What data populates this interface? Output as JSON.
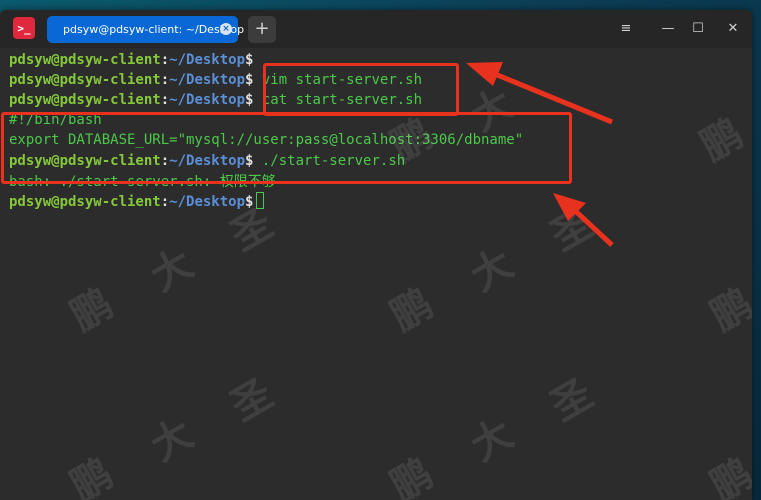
{
  "window": {
    "tab_title": "pdsyw@pdsyw-client: ~/Desktop",
    "tab_close_icon": "×",
    "new_tab_icon": "+",
    "menu_icon": "≡",
    "minimize_icon": "—",
    "maximize_icon": "☐",
    "close_icon": "✕",
    "app_icon_glyph": ">_"
  },
  "terminal": {
    "prompt_user": "pdsyw@pdsyw-client",
    "prompt_colon": ":",
    "prompt_path": "~/Desktop",
    "prompt_dollar": "$",
    "lines": [
      {
        "kind": "prompt",
        "cmd": ""
      },
      {
        "kind": "prompt",
        "cmd": " vim start-server.sh"
      },
      {
        "kind": "prompt",
        "cmd": " cat start-server.sh"
      },
      {
        "kind": "output",
        "text": "#!/bin/bash"
      },
      {
        "kind": "output",
        "text": "export DATABASE_URL=\"mysql://user:pass@localhost:3306/dbname\""
      },
      {
        "kind": "prompt",
        "cmd": " ./start-server.sh"
      },
      {
        "kind": "output",
        "text": "bash: ./start-server.sh: 权限不够"
      },
      {
        "kind": "prompt",
        "cmd": " "
      }
    ]
  },
  "watermark": {
    "chars": [
      "鹏",
      "大",
      "圣"
    ]
  },
  "colors": {
    "highlight": "#e8321e",
    "tab_active": "#0a68d6",
    "prompt_user": "#85c93a",
    "prompt_path": "#5b8fd8",
    "command_text": "#4cc84a"
  }
}
